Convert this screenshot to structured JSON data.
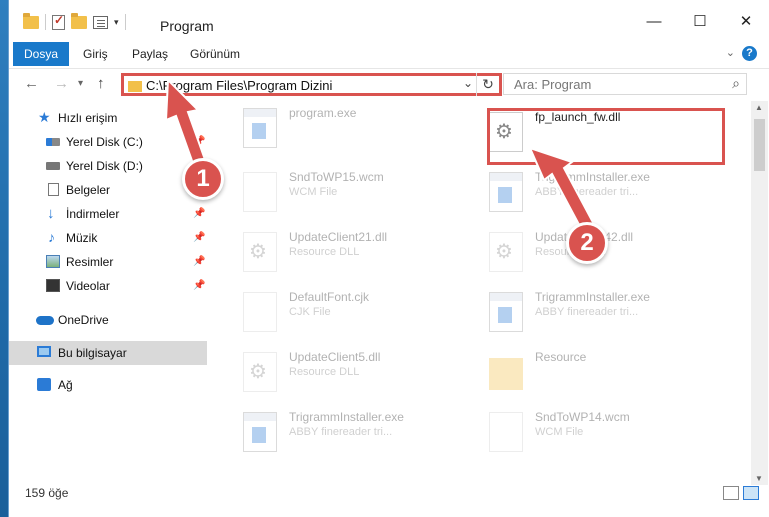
{
  "window": {
    "title": "Program"
  },
  "ribbon": {
    "tabs": [
      "Dosya",
      "Giriş",
      "Paylaş",
      "Görünüm"
    ]
  },
  "address": {
    "path": "C:\\Program Files\\Program Dizini"
  },
  "search": {
    "placeholder": "Ara: Program"
  },
  "sidebar": {
    "items": [
      {
        "label": "Hızlı erişim"
      },
      {
        "label": "Yerel Disk (C:)"
      },
      {
        "label": "Yerel Disk (D:)"
      },
      {
        "label": "Belgeler"
      },
      {
        "label": "İndirmeler"
      },
      {
        "label": "Müzik"
      },
      {
        "label": "Resimler"
      },
      {
        "label": "Videolar"
      },
      {
        "label": "OneDrive"
      },
      {
        "label": "Bu bilgisayar"
      },
      {
        "label": "Ağ"
      }
    ]
  },
  "files": [
    {
      "name": "program.exe",
      "type": ""
    },
    {
      "name": "fp_launch_fw.dll",
      "type": ""
    },
    {
      "name": "SndToWP15.wcm",
      "type": "WCM File"
    },
    {
      "name": "TrigrammInstaller.exe",
      "type": "ABBY finereader tri..."
    },
    {
      "name": "UpdateClient21.dll",
      "type": "Resource DLL"
    },
    {
      "name": "UpdateClient42.dll",
      "type": "Resource DLL"
    },
    {
      "name": "DefaultFont.cjk",
      "type": "CJK File"
    },
    {
      "name": "TrigrammInstaller.exe",
      "type": "ABBY finereader tri..."
    },
    {
      "name": "UpdateClient5.dll",
      "type": "Resource DLL"
    },
    {
      "name": "Resource",
      "type": ""
    },
    {
      "name": "TrigrammInstaller.exe",
      "type": "ABBY finereader tri..."
    },
    {
      "name": "SndToWP14.wcm",
      "type": "WCM File"
    }
  ],
  "status": {
    "count": "159 öğe"
  },
  "callouts": {
    "one": "1",
    "two": "2"
  },
  "icons": [
    "folder-icon",
    "checkbox-icon",
    "properties-icon",
    "minimize-icon",
    "maximize-icon",
    "close-icon",
    "back-icon",
    "forward-icon",
    "up-icon",
    "refresh-icon",
    "search-icon",
    "gear-icon"
  ],
  "colors": {
    "accent": "#1979ca",
    "highlight": "#d9534f"
  }
}
